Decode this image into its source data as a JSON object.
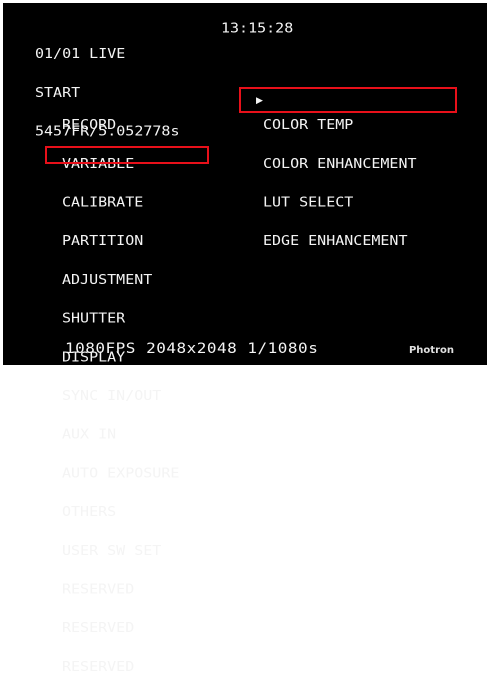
{
  "status": {
    "line1": "01/01 LIVE",
    "time": "13:15:28",
    "line2": "START",
    "line3": "5457FR/5.052778s"
  },
  "menu": {
    "items": [
      "RECORD",
      "VARIABLE",
      "CALIBRATE",
      "PARTITION",
      "ADJUSTMENT",
      "SHUTTER",
      "DISPLAY",
      "SYNC IN/OUT",
      "AUX IN",
      "AUTO EXPOSURE",
      "OTHERS",
      "USER SW SET",
      "RESERVED",
      "RESERVED",
      "RESERVED"
    ],
    "selected_index": 4
  },
  "submenu": {
    "items": [
      "COLOR TEMP",
      "COLOR ENHANCEMENT",
      "LUT SELECT",
      "EDGE ENHANCEMENT"
    ],
    "selected_index": 0,
    "cursor_icon": "triangle-right-icon"
  },
  "footer": {
    "settings": "1080FPS 2048x2048 1/1080s",
    "brand": "Photron"
  },
  "colors": {
    "background": "#000000",
    "text": "#f4f4f4",
    "highlight_box": "#e8101a"
  }
}
